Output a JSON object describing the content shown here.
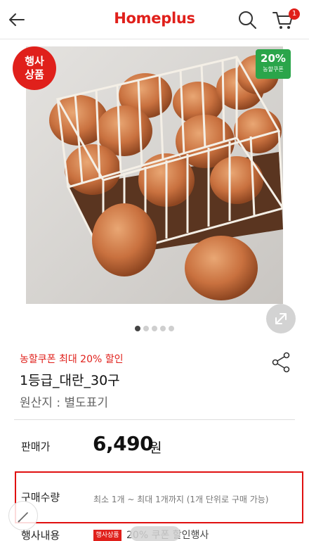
{
  "header": {
    "logo": "Homeplus",
    "cart_count": "1"
  },
  "product": {
    "event_badge_line1": "행사",
    "event_badge_line2": "상품",
    "coupon_badge_pct": "20%",
    "coupon_badge_label": "농할쿠폰",
    "image_count": 5,
    "image_index": 1,
    "coupon_line": "농할쿠폰 최대 20% 할인",
    "title": "1등급_대란_30구",
    "origin": "원산지 : 별도표기"
  },
  "price": {
    "label": "판매가",
    "value": "6,490",
    "unit": "원"
  },
  "quantity": {
    "label": "구매수량",
    "text": "최소 1개 ~ 최대 1개까지 (1개 단위로 구매 가능)"
  },
  "event": {
    "label": "행사내용",
    "tag": "행사상품",
    "text": "20% 쿠폰 할인행사"
  },
  "colors": {
    "brand": "#e0201b",
    "coupon_green": "#2aa54a",
    "highlight_border": "#e01010"
  },
  "icons": [
    "back-arrow-icon",
    "search-icon",
    "cart-icon",
    "expand-icon",
    "share-icon",
    "pencil-icon"
  ]
}
